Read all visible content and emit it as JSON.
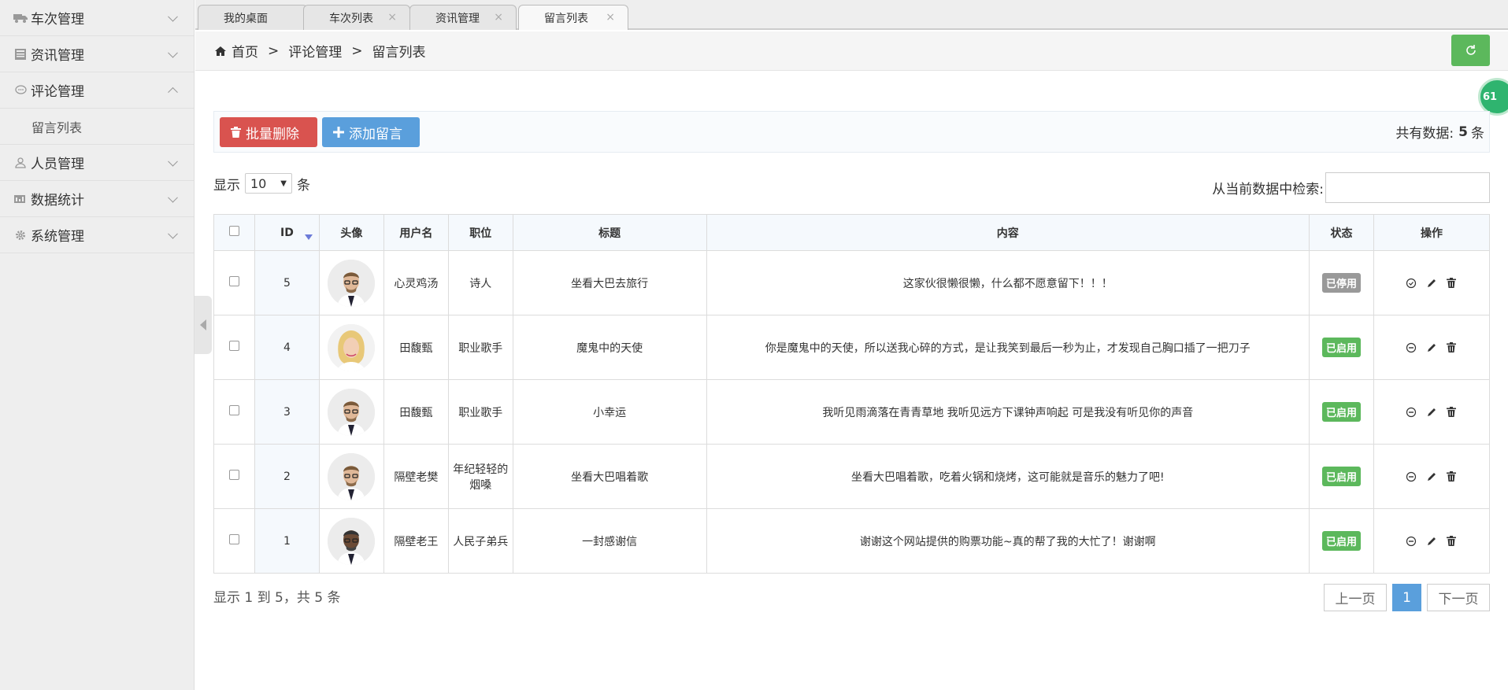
{
  "sidebar": {
    "items": [
      {
        "label": "车次管理",
        "icon": "truck-icon"
      },
      {
        "label": "资讯管理",
        "icon": "newspaper-icon"
      },
      {
        "label": "评论管理",
        "icon": "comment-icon",
        "expanded": true
      },
      {
        "label": "人员管理",
        "icon": "user-icon"
      },
      {
        "label": "数据统计",
        "icon": "chart-icon"
      },
      {
        "label": "系统管理",
        "icon": "gear-icon"
      }
    ],
    "submenu": {
      "label": "留言列表"
    }
  },
  "tabs": [
    {
      "label": "我的桌面",
      "closable": false
    },
    {
      "label": "车次列表",
      "closable": true
    },
    {
      "label": "资讯管理",
      "closable": true
    },
    {
      "label": "留言列表",
      "closable": true,
      "active": true
    }
  ],
  "breadcrumb": {
    "home": "首页",
    "sep": ">",
    "level1": "评论管理",
    "level2": "留言列表"
  },
  "float_badge": "61",
  "toolbar": {
    "batch_delete": "批量删除",
    "add": "添加留言",
    "total_prefix": "共有数据:",
    "total_count": "5",
    "total_unit": "条"
  },
  "length": {
    "prefix": "显示",
    "value": "10",
    "suffix": "条"
  },
  "search": {
    "label": "从当前数据中检索:"
  },
  "table": {
    "headers": {
      "id": "ID",
      "avatar": "头像",
      "username": "用户名",
      "position": "职位",
      "title": "标题",
      "content": "内容",
      "status": "状态",
      "actions": "操作"
    },
    "rows": [
      {
        "id": "5",
        "username": "心灵鸡汤",
        "position": "诗人",
        "title": "坐看大巴去旅行",
        "content": "这家伙很懒很懒，什么都不愿意留下！！！",
        "status": "已停用",
        "status_color": "#999999"
      },
      {
        "id": "4",
        "username": "田馥甄",
        "position": "职业歌手",
        "title": "魔鬼中的天使",
        "content": "你是魔鬼中的天使，所以送我心碎的方式，是让我笑到最后一秒为止，才发现自己胸口插了一把刀子",
        "status": "已启用",
        "status_color": "#5cb85c"
      },
      {
        "id": "3",
        "username": "田馥甄",
        "position": "职业歌手",
        "title": "小幸运",
        "content": "我听见雨滴落在青青草地 我听见远方下课钟声响起 可是我没有听见你的声音",
        "status": "已启用",
        "status_color": "#5cb85c"
      },
      {
        "id": "2",
        "username": "隔壁老樊",
        "position": "年纪轻轻的烟嗓",
        "title": "坐看大巴唱着歌",
        "content": "坐看大巴唱着歌，吃着火锅和烧烤，这可能就是音乐的魅力了吧!",
        "status": "已启用",
        "status_color": "#5cb85c"
      },
      {
        "id": "1",
        "username": "隔壁老王",
        "position": "人民子弟兵",
        "title": "一封感谢信",
        "content": "谢谢这个网站提供的购票功能~真的帮了我的大忙了！谢谢啊",
        "status": "已启用",
        "status_color": "#5cb85c"
      }
    ]
  },
  "info": "显示 1 到 5，共 5 条",
  "pager": {
    "prev": "上一页",
    "current": "1",
    "next": "下一页"
  }
}
